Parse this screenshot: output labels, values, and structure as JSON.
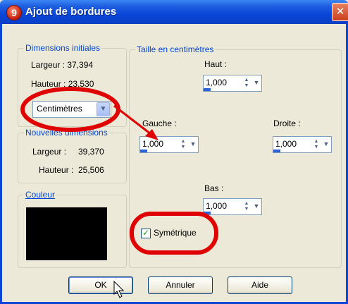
{
  "window": {
    "title": "Ajout de bordures",
    "icon": "9",
    "close_glyph": "✕"
  },
  "initial": {
    "legend": "Dimensions initiales",
    "width_label": "Largeur : 37,394",
    "height_label": "Hauteur : 23,530"
  },
  "unit_select": {
    "value": "Centimètres"
  },
  "new_dims": {
    "legend": "Nouvelles dimensions",
    "width_label": "Largeur :",
    "width_value": "39,370",
    "height_label": "Hauteur :",
    "height_value": "25,506"
  },
  "color": {
    "legend": "Couleur",
    "swatch": "#000000"
  },
  "size": {
    "legend": "Taille en centimètres",
    "top_label": "Haut :",
    "top_value": "1,000",
    "left_label": "Gauche :",
    "left_value": "1,000",
    "right_label": "Droite :",
    "right_value": "1,000",
    "bottom_label": "Bas :",
    "bottom_value": "1,000"
  },
  "symmetric": {
    "label": "Symétrique",
    "checked": true
  },
  "buttons": {
    "ok": "OK",
    "cancel": "Annuler",
    "help": "Aide"
  },
  "annotation_color": "#e00000"
}
